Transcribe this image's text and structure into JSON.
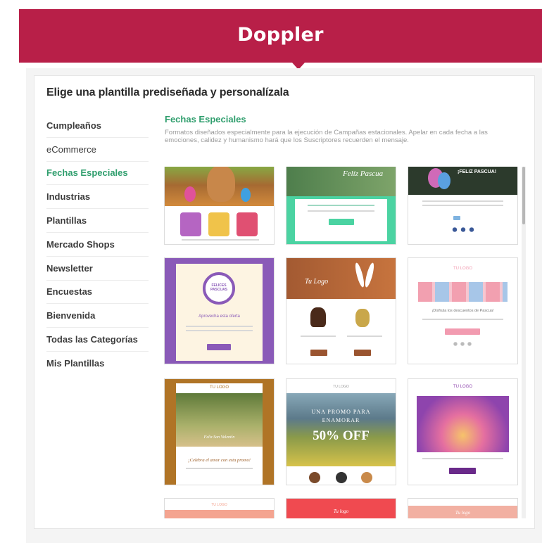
{
  "header": {
    "brand": "Doppler"
  },
  "page": {
    "title": "Elige una plantilla prediseñada y personalízala"
  },
  "sidebar": {
    "items": [
      {
        "label": "Cumpleaños"
      },
      {
        "label": "eCommerce"
      },
      {
        "label": "Fechas Especiales"
      },
      {
        "label": "Industrias"
      },
      {
        "label": "Plantillas"
      },
      {
        "label": "Mercado Shops"
      },
      {
        "label": "Newsletter"
      },
      {
        "label": "Encuestas"
      },
      {
        "label": "Bienvenida"
      },
      {
        "label": "Todas las Categorías"
      },
      {
        "label": "Mis Plantillas"
      }
    ],
    "active": "Fechas Especiales"
  },
  "section": {
    "title": "Fechas Especiales",
    "description": "Formatos diseñados especialmente para la ejecución de Campañas estacionales. Apelar en cada fecha a las emociones, calidez y humanismo hará que los Suscriptores recuerden el mensaje."
  },
  "templates": {
    "t2_heading": "Felíz Pascua",
    "t3_heading": "¡FELIZ PASCUA!",
    "t4_circle": "FELICES PASCUAS",
    "t4_offer": "Aprovecha esta oferta",
    "t5_logo": "Tu Logo",
    "t6_logo": "TU LOGO",
    "t6_text": "¡Disfruta los descuentos de Pascua!",
    "t7_logo": "TU LOGO",
    "t7_script": "Feliz San Valentín",
    "t7_text": "¡Celebra el amor con esta promo!",
    "t8_logo": "TU LOGO",
    "t8_line1": "UNA PROMO PARA",
    "t8_line2": "ENAMORAR",
    "t8_offer": "50% OFF",
    "t9_logo": "TU LOGO",
    "t10_logo": "TU LOGO",
    "t11_logo": "Tu logo",
    "t12_logo": "Tu logo"
  },
  "colors": {
    "brand": "#b81f48",
    "accent_green": "#2f9e6d",
    "mint": "#4bd3a2",
    "purple": "#8a5ab8",
    "salmon": "#f4a490",
    "coral": "#f04a50"
  }
}
